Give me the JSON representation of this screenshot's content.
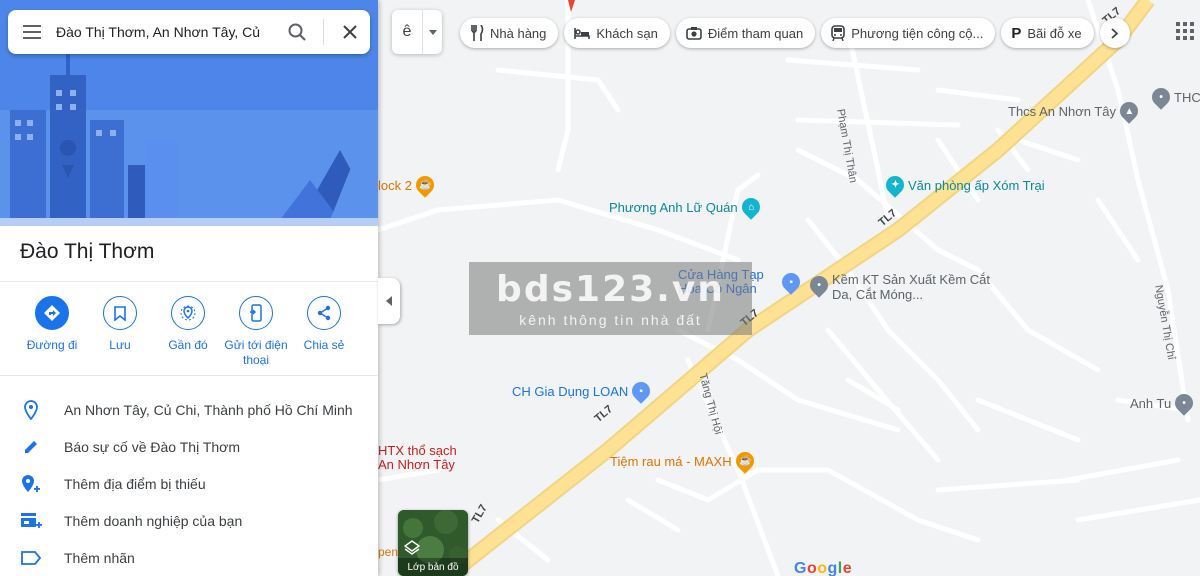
{
  "search": {
    "query": "Đào Thị Thơm, An Nhơn Tây, Củ"
  },
  "place": {
    "title": "Đào Thị Thơm"
  },
  "actions": [
    {
      "label": "Đường đi",
      "icon": "directions-icon"
    },
    {
      "label": "Lưu",
      "icon": "bookmark-icon"
    },
    {
      "label": "Gần đó",
      "icon": "nearby-icon"
    },
    {
      "label": "Gửi tới điện thoại",
      "icon": "send-to-phone-icon"
    },
    {
      "label": "Chia sẻ",
      "icon": "share-icon"
    }
  ],
  "info": [
    {
      "text": "An Nhơn Tây, Củ Chi, Thành phố Hồ Chí Minh",
      "icon": "location-pin-icon"
    },
    {
      "text": "Báo sự cố về Đào Thị Thơm",
      "icon": "edit-pencil-icon"
    },
    {
      "text": "Thêm địa điểm bị thiếu",
      "icon": "add-place-icon"
    },
    {
      "text": "Thêm doanh nghiệp của bạn",
      "icon": "add-business-icon"
    },
    {
      "text": "Thêm nhãn",
      "icon": "label-icon"
    }
  ],
  "layer_switch": {
    "glyph": "ê"
  },
  "chips": [
    {
      "label": "Nhà hàng",
      "icon": "restaurant-icon"
    },
    {
      "label": "Khách sạn",
      "icon": "hotel-icon"
    },
    {
      "label": "Điểm tham quan",
      "icon": "camera-icon"
    },
    {
      "label": "Phương tiện công cộ...",
      "icon": "transit-icon"
    },
    {
      "label": "Bãi đỗ xe",
      "icon": "parking-icon",
      "glyph": "P"
    }
  ],
  "map": {
    "pois": [
      {
        "name": "Phương Anh Lữ Quán",
        "color": "#12b5cb",
        "icon": "hotel-pin-icon"
      },
      {
        "name": "Văn phòng ấp Xóm Trại",
        "color": "#12b5cb",
        "icon": "office-pin-icon"
      },
      {
        "name": "Thcs An Nhơn Tây",
        "color": "#7b8794",
        "icon": "school-pin-icon"
      },
      {
        "name": "THCS",
        "color": "#7b8794",
        "icon": "place-pin-icon"
      },
      {
        "name": "Cửa Hàng Tạp Hóa Cô Ngân",
        "color": "#5e97f6",
        "icon": "shop-pin-icon"
      },
      {
        "name": "Kềm KT Sản Xuất Kềm Cắt Da, Cắt Móng...",
        "color": "#7b8794",
        "icon": "place-pin-icon"
      },
      {
        "name": "CH Gia Dụng LOAN",
        "color": "#5e97f6",
        "icon": "shop-pin-icon"
      },
      {
        "name": "Anh Tu",
        "color": "#7b8794",
        "icon": "place-pin-icon"
      },
      {
        "name": "Tiệm rau má - MAXH",
        "color": "#f29900",
        "icon": "cafe-pin-icon"
      },
      {
        "name": "lock 2",
        "color": "#f29900",
        "icon": "cafe-pin-icon"
      },
      {
        "name": "HTX thổ sạch An Nhơn Tây",
        "color": "#e8453c",
        "icon": "place-pin-icon"
      },
      {
        "name": "pen",
        "color": "#f29900",
        "icon": "place-pin-icon"
      }
    ],
    "streets": [
      "Phạm Thị Thân",
      "Tăng Thị Hội",
      "Nguyễn Thị Chỉ"
    ],
    "road_label": "TL7"
  },
  "watermark": {
    "main": "bds123.vn",
    "sub": "kênh thông tin nhà đất"
  },
  "layers": {
    "label": "Lớp bản đồ"
  },
  "google": {
    "letters": [
      "G",
      "o",
      "o",
      "g",
      "l",
      "e"
    ],
    "colors": [
      "#4285f4",
      "#ea4335",
      "#fbbc05",
      "#4285f4",
      "#34a853",
      "#ea4335"
    ]
  }
}
